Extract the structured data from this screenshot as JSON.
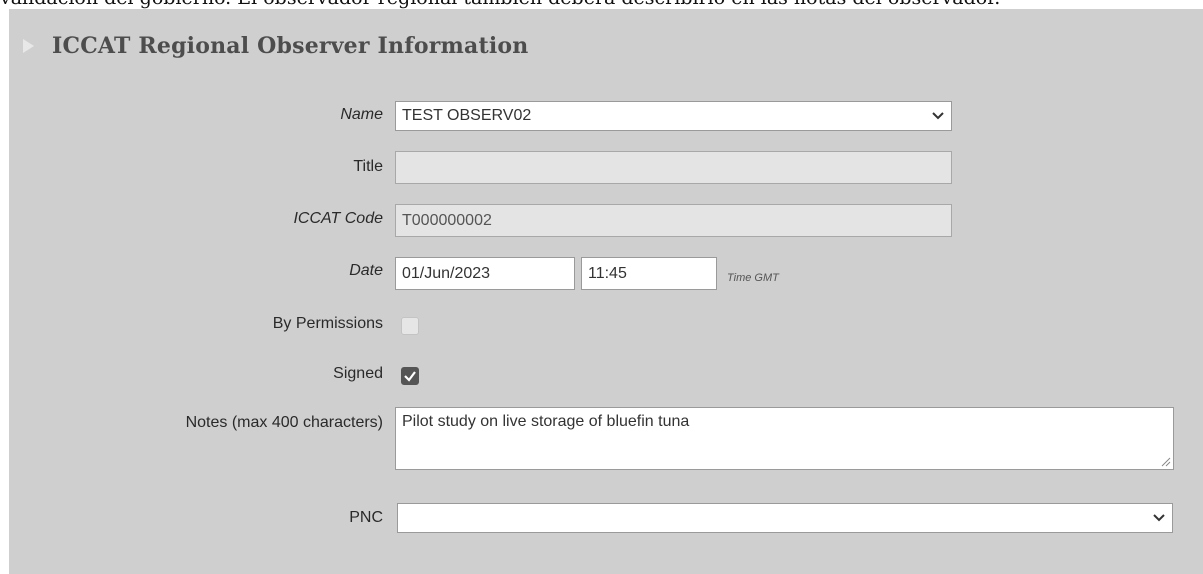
{
  "top_text": "validación del gobierno. El observador regional también deberá describirlo en las notas del observador.",
  "section": {
    "title": "ICCAT Regional Observer Information",
    "expand_icon": "triangle-right-icon"
  },
  "form": {
    "name": {
      "label": "Name",
      "value": "TEST OBSERV02"
    },
    "title": {
      "label": "Title",
      "value": ""
    },
    "iccat_code": {
      "label": "ICCAT Code",
      "value": "T000000002"
    },
    "date": {
      "label": "Date",
      "date_value": "01/Jun/2023",
      "time_value": "11:45",
      "time_hint": "Time GMT"
    },
    "by_permissions": {
      "label": "By Permissions",
      "checked": false
    },
    "signed": {
      "label": "Signed",
      "checked": true
    },
    "notes": {
      "label": "Notes (max 400 characters)",
      "value": "Pilot study on live storage of bluefin tuna"
    },
    "pnc": {
      "label": "PNC",
      "value": ""
    }
  },
  "colors": {
    "panel_bg": "#cfcfcf",
    "readonly_field_bg": "#e4e4e4",
    "title_text": "#4d4d4d",
    "checkbox_checked": "#555555"
  }
}
